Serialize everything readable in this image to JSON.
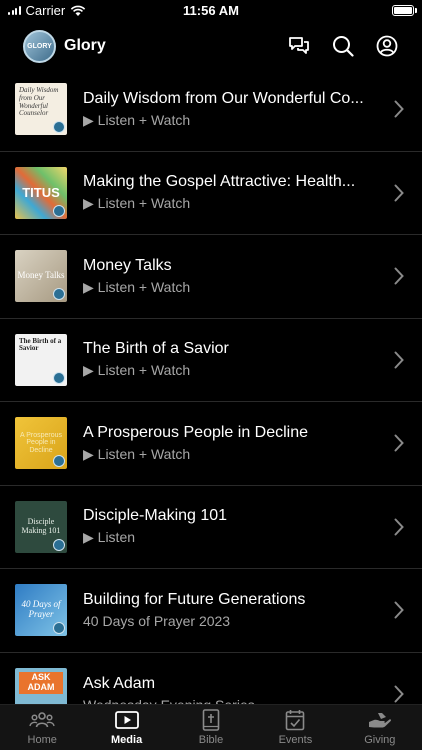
{
  "status": {
    "carrier": "Carrier",
    "time": "11:56 AM"
  },
  "header": {
    "logo_text": "GLORY",
    "title": "Glory"
  },
  "thumb_text": {
    "t1": "Daily Wisdom from Our Wonderful Counselor",
    "t2": "TITUS",
    "t3": "Money Talks",
    "t4": "The Birth of a Savior",
    "t5": "A Prosperous People in Decline",
    "t6": "Disciple Making 101",
    "t7": "40 Days of Prayer",
    "t8": "ASK ADAM"
  },
  "items": [
    {
      "title": "Daily Wisdom from Our Wonderful Co...",
      "subtitle": "▶ Listen + Watch"
    },
    {
      "title": "Making the Gospel Attractive: Health...",
      "subtitle": "▶ Listen + Watch"
    },
    {
      "title": "Money Talks",
      "subtitle": "▶ Listen + Watch"
    },
    {
      "title": "The Birth of a Savior",
      "subtitle": "▶ Listen + Watch"
    },
    {
      "title": "A Prosperous People in Decline",
      "subtitle": "▶ Listen + Watch"
    },
    {
      "title": "Disciple-Making 101",
      "subtitle": "▶ Listen"
    },
    {
      "title": "Building for Future Generations",
      "subtitle": "40 Days of Prayer 2023"
    },
    {
      "title": "Ask Adam",
      "subtitle": "Wednesday Evening Series"
    }
  ],
  "tabs": [
    {
      "label": "Home",
      "icon": "people-icon"
    },
    {
      "label": "Media",
      "icon": "play-icon"
    },
    {
      "label": "Bible",
      "icon": "bible-icon"
    },
    {
      "label": "Events",
      "icon": "calendar-icon"
    },
    {
      "label": "Giving",
      "icon": "giving-icon"
    }
  ],
  "colors": {
    "background": "#000000",
    "subtitle": "#a7a7a7",
    "tab_inactive": "#8a8a8a"
  }
}
